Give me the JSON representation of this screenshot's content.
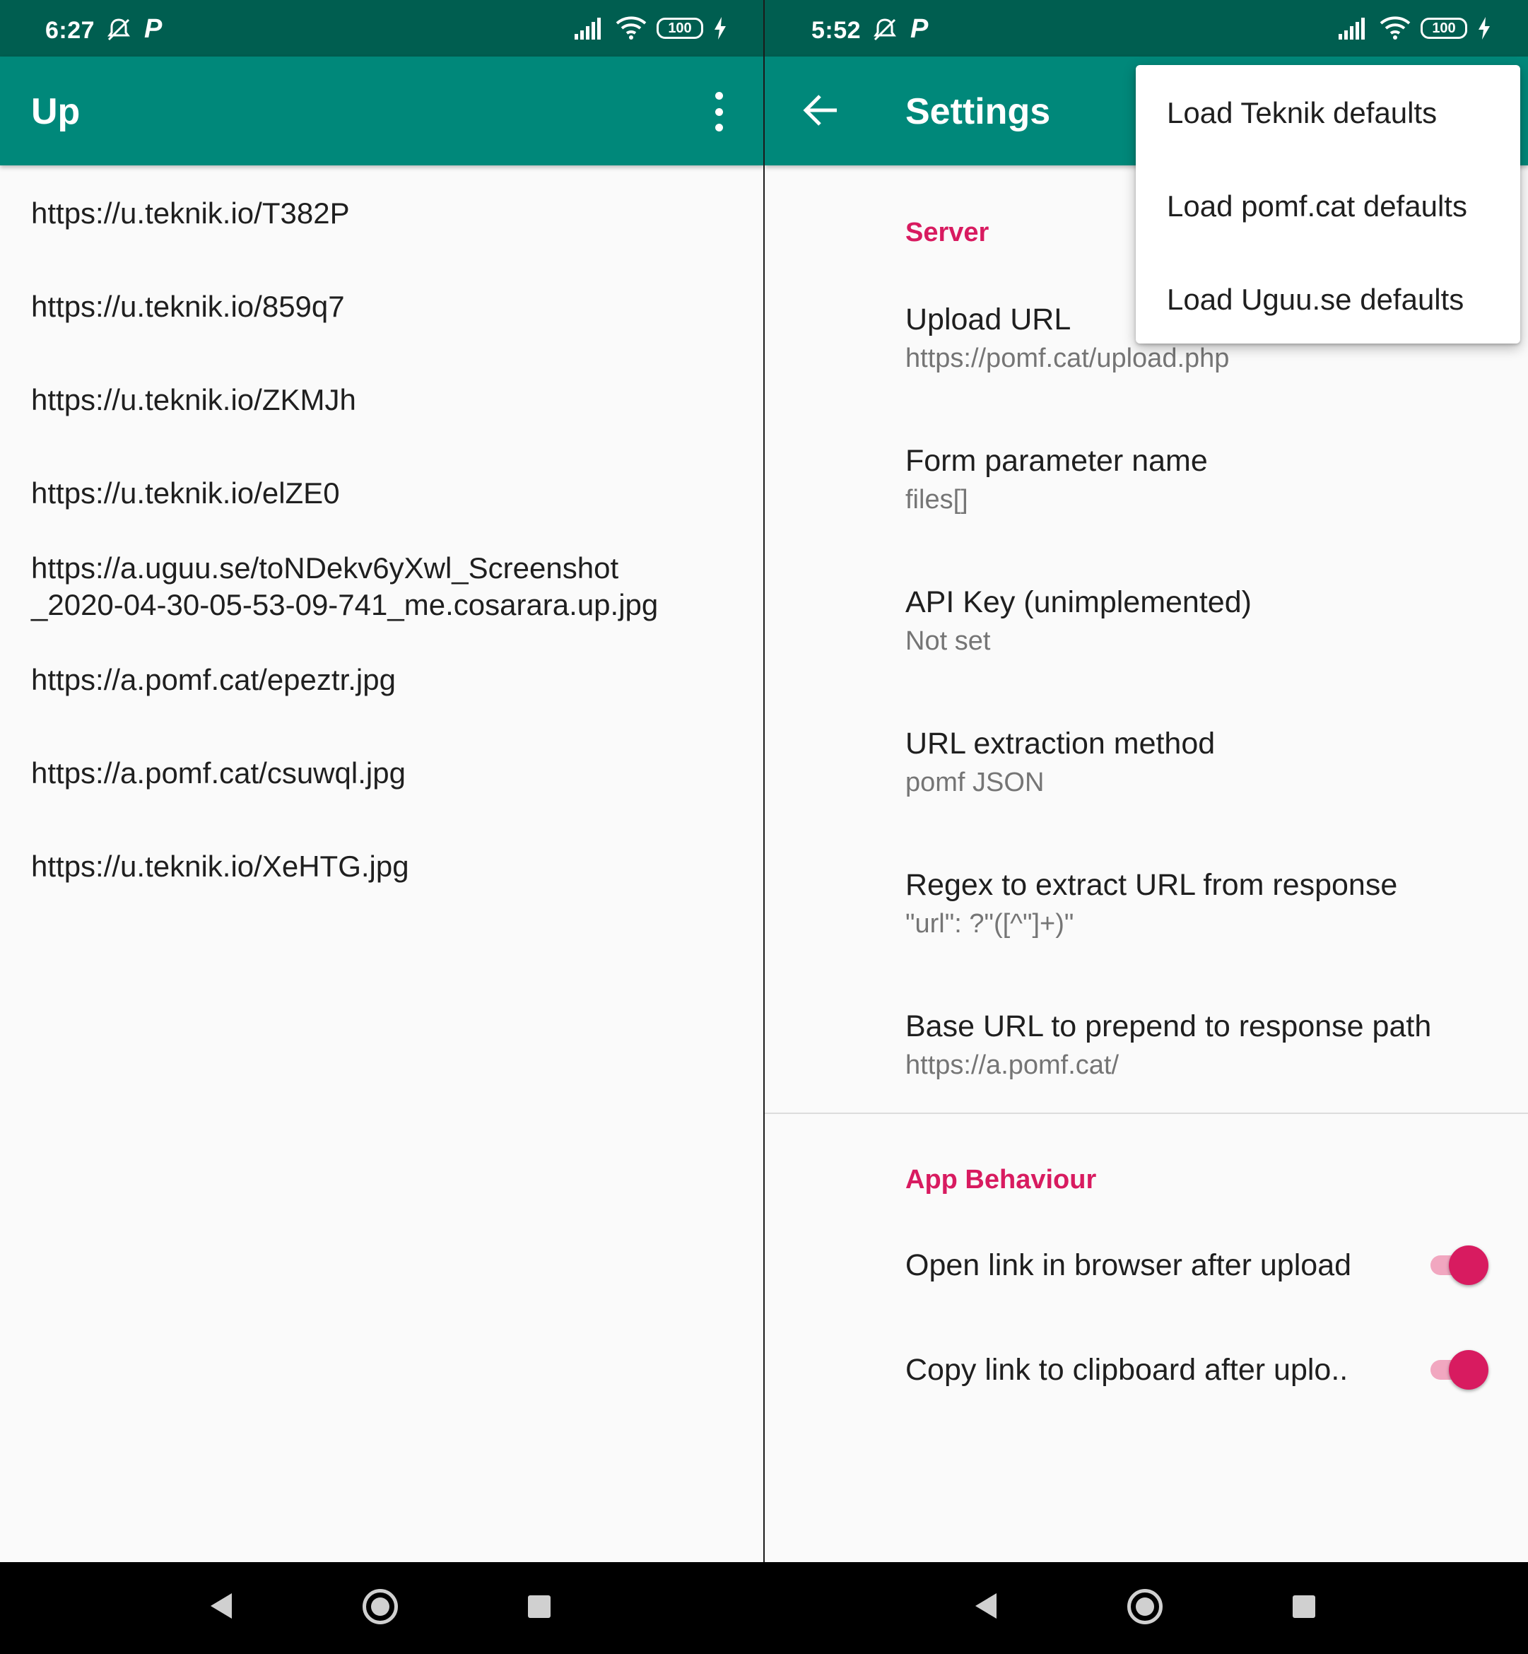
{
  "left": {
    "status": {
      "time": "6:27",
      "battery": "100"
    },
    "appbar": {
      "title": "Up"
    },
    "urls": [
      "https://u.teknik.io/T382P",
      "https://u.teknik.io/859q7",
      "https://u.teknik.io/ZKMJh",
      "https://u.teknik.io/elZE0",
      "https://a.uguu.se/toNDekv6yXwl_Screenshot",
      "_2020-04-30-05-53-09-741_me.cosarara.up.jpg",
      "https://a.pomf.cat/epeztr.jpg",
      "https://a.pomf.cat/csuwql.jpg",
      "https://u.teknik.io/XeHTG.jpg"
    ]
  },
  "right": {
    "status": {
      "time": "5:52",
      "battery": "100"
    },
    "appbar": {
      "title": "Settings"
    },
    "server": {
      "category": "Server",
      "upload_url": {
        "title": "Upload URL",
        "summary": "https://pomf.cat/upload.php"
      },
      "form_param": {
        "title": "Form parameter name",
        "summary": "files[]"
      },
      "api_key": {
        "title": "API Key (unimplemented)",
        "summary": "Not set"
      },
      "extraction": {
        "title": "URL extraction method",
        "summary": "pomf JSON"
      },
      "regex": {
        "title": "Regex to extract URL from response",
        "summary": "\"url\": ?\"([^\"]+)\""
      },
      "base_url": {
        "title": "Base URL to prepend to response path",
        "summary": "https://a.pomf.cat/"
      }
    },
    "behaviour": {
      "category": "App Behaviour",
      "open_link": {
        "title": "Open link in browser after upload",
        "checked": true
      },
      "copy_link": {
        "title": "Copy link to clipboard after uplo..",
        "checked": true
      }
    },
    "menu": {
      "items": [
        "Load Teknik defaults",
        "Load pomf.cat defaults",
        "Load Uguu.se defaults"
      ]
    }
  },
  "colors": {
    "statusbar": "#005e50",
    "appbar": "#00887a",
    "accent": "#d81b60"
  }
}
